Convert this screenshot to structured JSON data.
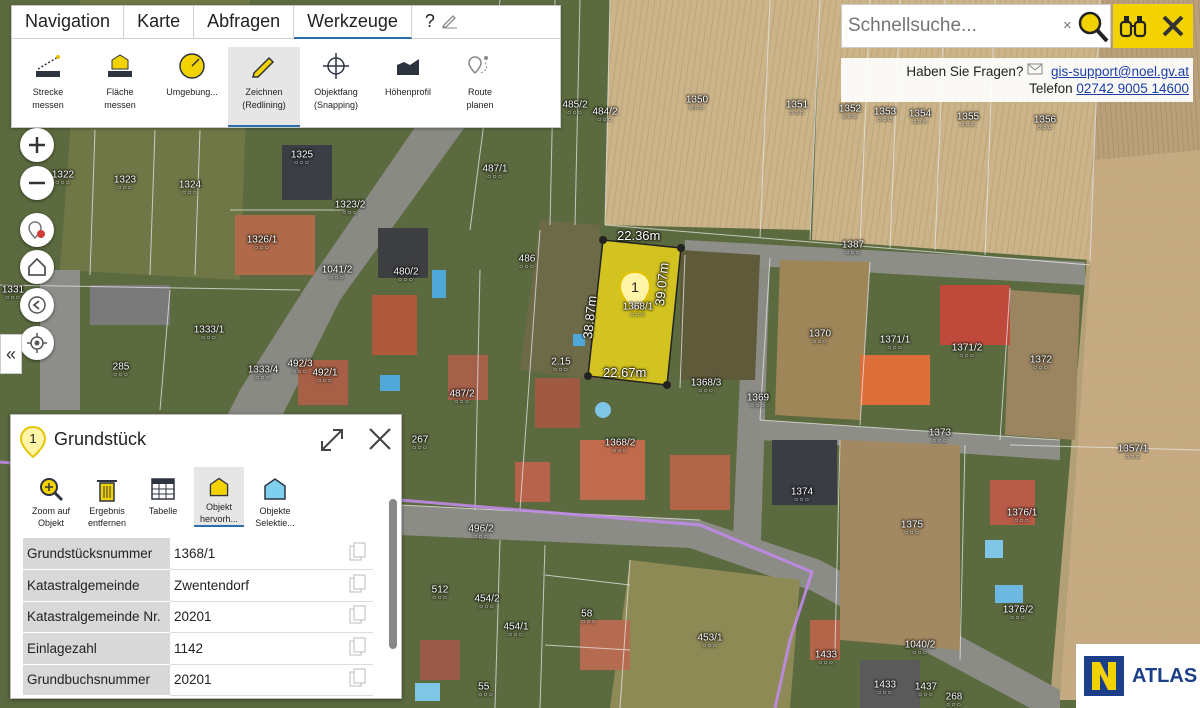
{
  "menu": {
    "tabs": [
      {
        "label": "Navigation"
      },
      {
        "label": "Karte"
      },
      {
        "label": "Abfragen"
      },
      {
        "label": "Werkzeuge",
        "active": true
      },
      {
        "label": "?"
      }
    ],
    "tools": [
      {
        "line1": "Strecke",
        "line2": "messen",
        "icon": "ruler-line-icon"
      },
      {
        "line1": "Fläche",
        "line2": "messen",
        "icon": "area-measure-icon"
      },
      {
        "line1": "Umgebung...",
        "line2": "",
        "icon": "compass-icon"
      },
      {
        "line1": "Zeichnen",
        "line2": "(Redlining)",
        "icon": "pencil-icon",
        "active": true
      },
      {
        "line1": "Objektfang",
        "line2": "(Snapping)",
        "icon": "crosshair-icon"
      },
      {
        "line1": "Höhenprofil",
        "line2": "",
        "icon": "elevation-profile-icon"
      },
      {
        "line1": "Route",
        "line2": "planen",
        "icon": "route-pin-icon"
      }
    ]
  },
  "search": {
    "placeholder": "Schnellsuche...",
    "clear": "×"
  },
  "support": {
    "question": "Haben Sie Fragen?",
    "email": "gis-support@noel.gv.at",
    "phone_label": "Telefon",
    "phone": "02742 9005 14600"
  },
  "controls": {
    "collapse": "«"
  },
  "panel": {
    "title": "Grundstück",
    "pin_number": "1",
    "tools": [
      {
        "line1": "Zoom auf",
        "line2": "Objekt",
        "icon": "zoom-to-object-icon"
      },
      {
        "line1": "Ergebnis",
        "line2": "entfernen",
        "icon": "trash-icon"
      },
      {
        "line1": "Tabelle",
        "line2": "",
        "icon": "table-icon"
      },
      {
        "line1": "Objekt",
        "line2": "hervorh...",
        "icon": "highlight-object-icon",
        "active": true
      },
      {
        "line1": "Objekte",
        "line2": "Selektie...",
        "icon": "select-objects-icon"
      }
    ],
    "attributes": [
      {
        "key": "Grundstücksnummer",
        "value": "1368/1"
      },
      {
        "key": "Katastralgemeinde",
        "value": "Zwentendorf"
      },
      {
        "key": "Katastralgemeinde Nr.",
        "value": "20201"
      },
      {
        "key": "Einlagezahl",
        "value": "1142"
      },
      {
        "key": "Grundbuchsnummer",
        "value": "20201"
      }
    ]
  },
  "map": {
    "selected_marker": "1",
    "dimensions": [
      "22.36m",
      "39.07m",
      "22.67m",
      "38.87m"
    ],
    "parcels": [
      "1350",
      "1351",
      "1352",
      "1353",
      "1354",
      "1355",
      "1356",
      "485/2",
      "484/2",
      "1325",
      "1323/2",
      "487/1",
      "1322",
      "1323",
      "1324",
      "1326/1",
      "1041/2",
      "480/2",
      "486",
      "1387",
      "1331",
      "1333/1",
      "1370",
      "1371/1",
      "1371/2",
      "1372",
      "285",
      "1333/4",
      "492/3",
      "492/1",
      "487/2",
      "2.15",
      "1368/3",
      "1369",
      "1373",
      "267",
      "1368/2",
      "1374",
      "1357/1",
      "1375",
      "1376/1",
      "1376/2",
      "496/2",
      "512",
      "454/2",
      "454/1",
      "58",
      "453/1",
      "1433",
      "1040/2",
      "1437",
      "268",
      "1433",
      "55",
      "1368/1"
    ],
    "colors": {
      "selection_fill": "#e6d21c",
      "boundary": "#b48ad6",
      "accent": "#2b6fa8",
      "brand_yellow": "#f2d200"
    }
  },
  "logo": {
    "text": "ATLAS",
    "letter": "N"
  }
}
